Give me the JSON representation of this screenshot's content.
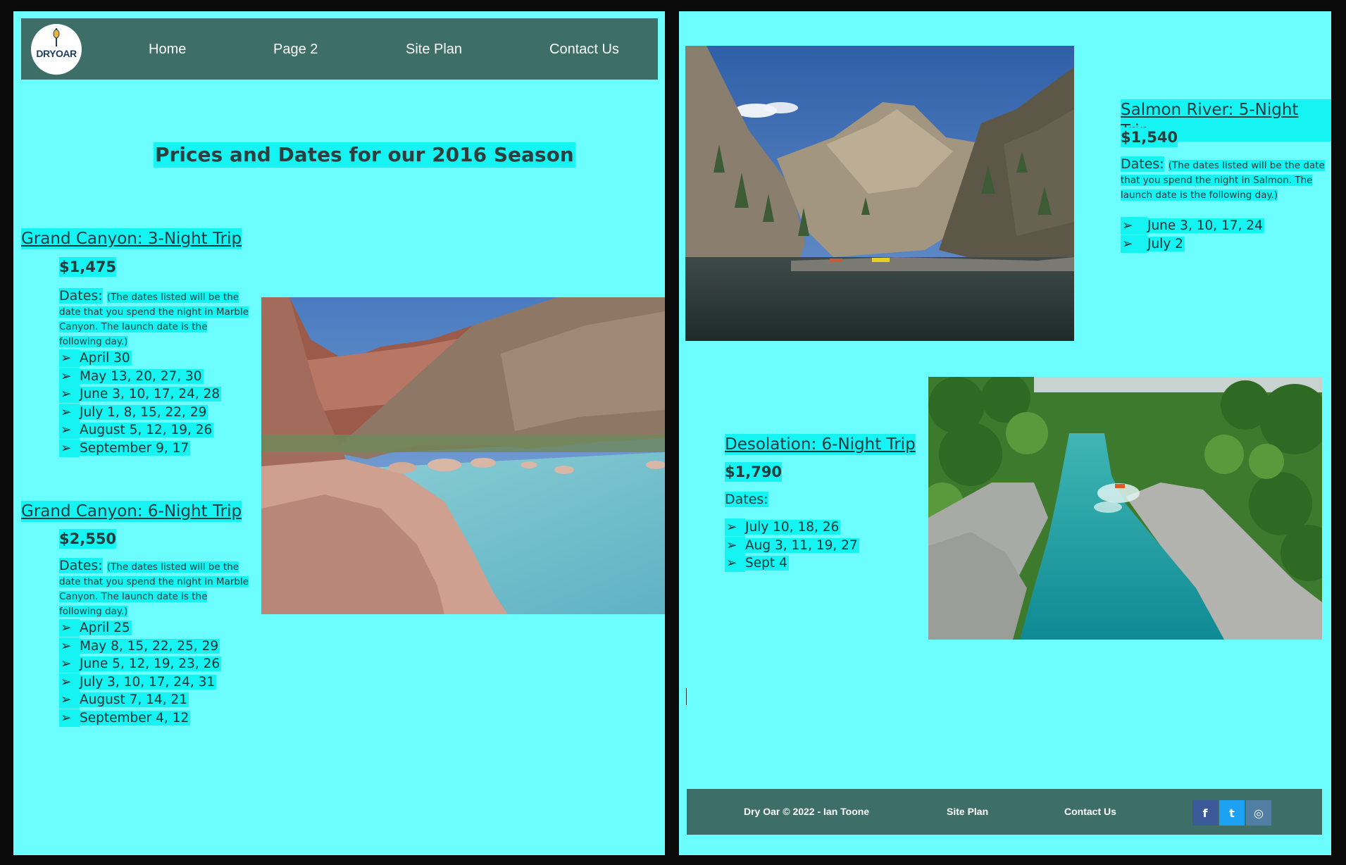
{
  "nav": {
    "logo_text": "DRYOAR",
    "links": [
      "Home",
      "Page 2",
      "Site Plan",
      "Contact Us"
    ]
  },
  "title": "Prices and Dates for our 2016 Season",
  "trips": [
    {
      "name": "Grand Canyon: 3-Night Trip",
      "price": "$1,475",
      "dates_label": "Dates:",
      "note": "(The dates listed will be the date that you spend the night in Marble Canyon. The launch date is the following day.)",
      "dates": [
        "April 30",
        "May 13, 20, 27, 30",
        "June 3, 10, 17, 24, 28",
        "July 1, 8, 15, 22, 29",
        "August 5, 12, 19, 26",
        "September 9, 17"
      ]
    },
    {
      "name": "Grand Canyon: 6-Night Trip",
      "price": "$2,550",
      "dates_label": "Dates:",
      "note": "(The dates listed will be the date that you spend the night in Marble Canyon. The launch date is the following day.)",
      "dates": [
        "April 25",
        "May 8, 15, 22, 25, 29",
        "June 5, 12, 19, 23, 26",
        "July 3, 10, 17, 24, 31",
        "August 7, 14, 21",
        "September 4, 12"
      ]
    },
    {
      "name": "Salmon River: 5-Night Trip",
      "price": "$1,540",
      "dates_label": "Dates:",
      "note": "(The dates listed will be the date that you spend the night in Salmon. The launch date is the following day.)",
      "dates": [
        "June 3, 10, 17, 24",
        "July 2"
      ]
    },
    {
      "name": "Desolation: 6-Night Trip",
      "price": "$1,790",
      "dates_label": "Dates:",
      "dates": [
        "July 10, 18, 26",
        "Aug 3, 11, 19, 27",
        "Sept 4"
      ]
    }
  ],
  "bullet": "➢",
  "footer": {
    "copyright": "Dry Oar © 2022 - Ian Toone",
    "site_plan": "Site Plan",
    "contact": "Contact Us",
    "social": [
      {
        "icon": "facebook-icon",
        "glyph": "f",
        "color": "#3b5998"
      },
      {
        "icon": "twitter-icon",
        "glyph": "t",
        "color": "#1da1f2"
      },
      {
        "icon": "instagram-icon",
        "glyph": "◎",
        "color": "#517fa4"
      }
    ]
  },
  "colors": {
    "page_bg": "#6cfefe",
    "highlight": "#16f3f3",
    "nav_bg": "#3d6e67",
    "outer_bg": "#0b0b0b"
  }
}
